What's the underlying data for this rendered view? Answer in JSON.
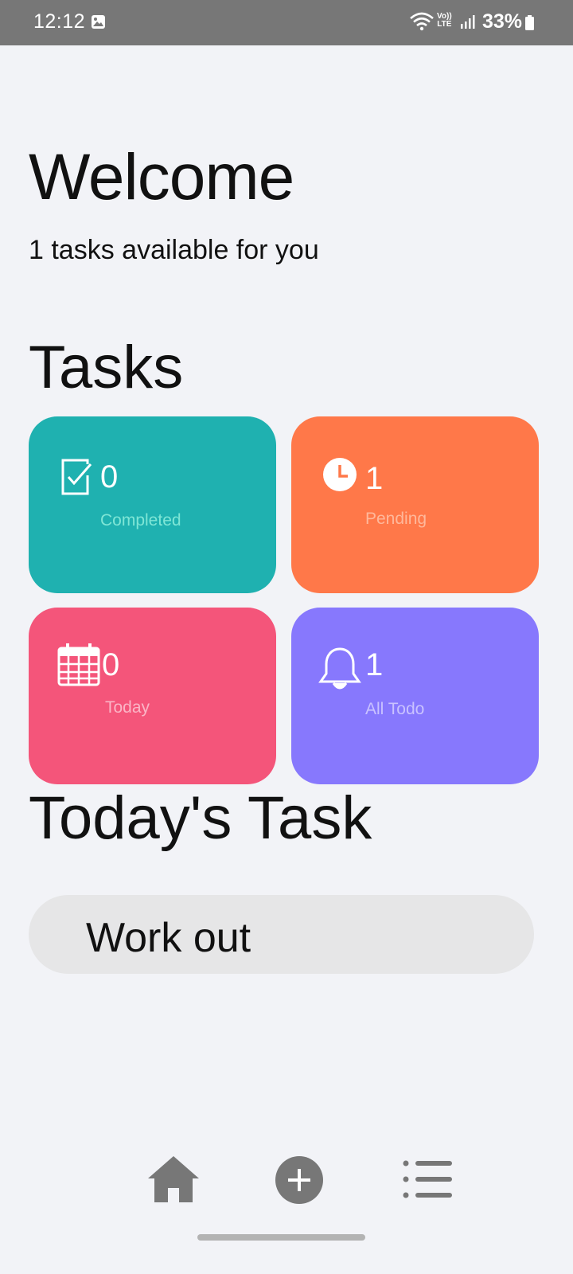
{
  "status_bar": {
    "time": "12:12",
    "volte_top": "Vo))",
    "volte_bottom": "LTE",
    "battery": "33%"
  },
  "header": {
    "title": "Welcome",
    "subtitle": "1 tasks available for you"
  },
  "tasks_section": {
    "title": "Tasks",
    "cards": [
      {
        "count": "0",
        "label": "Completed",
        "icon": "checkbox-icon",
        "color": "#1fb1b0"
      },
      {
        "count": "1",
        "label": "Pending",
        "icon": "clock-icon",
        "color": "#ff7849"
      },
      {
        "count": "0",
        "label": "Today",
        "icon": "calendar-icon",
        "color": "#f4557a"
      },
      {
        "count": "1",
        "label": "All Todo",
        "icon": "bell-icon",
        "color": "#8778fd"
      }
    ]
  },
  "today_section": {
    "title": "Today's Task",
    "tasks": [
      {
        "title": "Work out"
      }
    ]
  },
  "bottom_nav": {
    "items": [
      {
        "icon": "home-icon"
      },
      {
        "icon": "add-circle-icon"
      },
      {
        "icon": "list-icon"
      }
    ]
  }
}
